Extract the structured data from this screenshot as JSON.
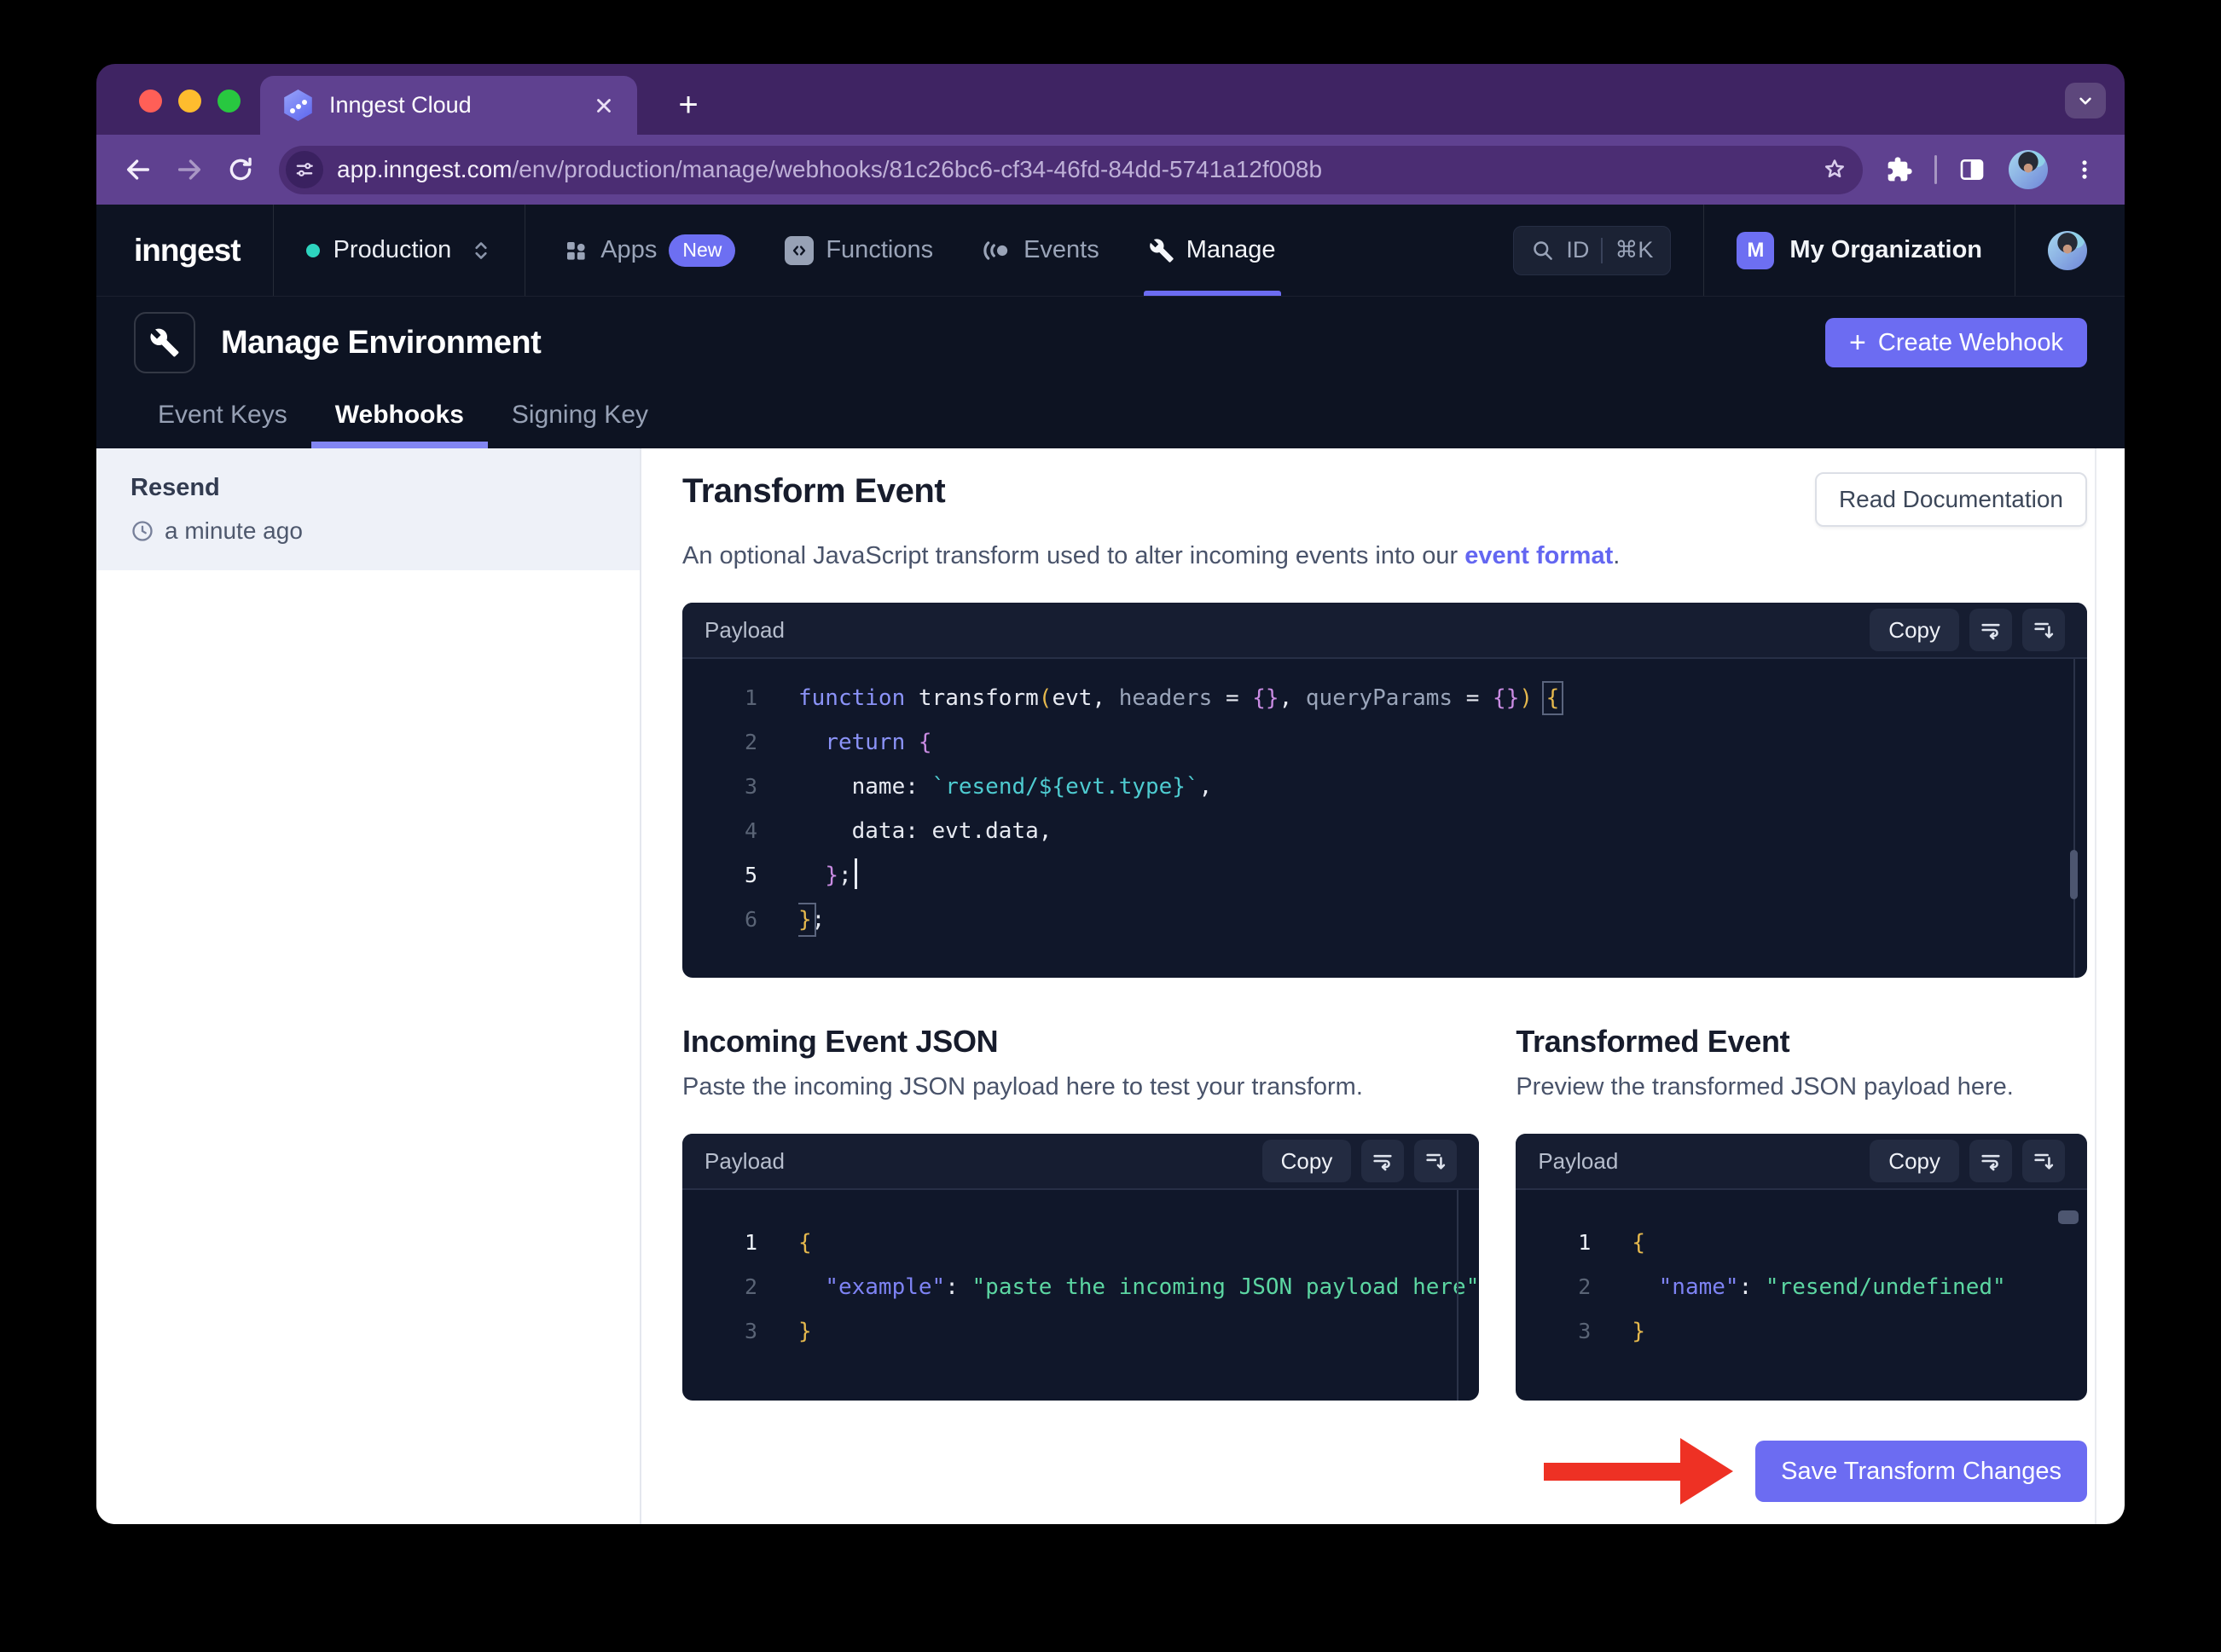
{
  "browser": {
    "tab_title": "Inngest Cloud",
    "url_host": "app.inngest.com",
    "url_path": "/env/production/manage/webhooks/81c26bc6-cf34-46fd-84dd-5741a12f008b"
  },
  "topnav": {
    "logo": "inngest",
    "env_selector": {
      "label": "Production"
    },
    "items": [
      {
        "label": "Apps",
        "badge": "New",
        "active": false
      },
      {
        "label": "Functions",
        "active": false
      },
      {
        "label": "Events",
        "active": false
      },
      {
        "label": "Manage",
        "active": true
      }
    ],
    "search": {
      "id_label": "ID",
      "shortcut": "⌘K"
    },
    "org": {
      "initial": "M",
      "name": "My Organization"
    }
  },
  "env_header": {
    "title": "Manage Environment",
    "create_button": "Create Webhook",
    "tabs": [
      {
        "label": "Event Keys",
        "active": false
      },
      {
        "label": "Webhooks",
        "active": true
      },
      {
        "label": "Signing Key",
        "active": false
      }
    ]
  },
  "sidebar": {
    "items": [
      {
        "name": "Resend",
        "time": "a minute ago"
      }
    ]
  },
  "transform": {
    "title": "Transform Event",
    "description_prefix": "An optional JavaScript transform used to alter incoming events into our ",
    "description_link": "event format",
    "description_suffix": ".",
    "read_docs_button": "Read Documentation"
  },
  "editors": {
    "panel_label": "Payload",
    "copy_label": "Copy",
    "transform_code": {
      "active": 5,
      "lines": [
        [
          {
            "c": "kw",
            "t": "function"
          },
          {
            "c": "pl",
            "t": " transform"
          },
          {
            "c": "yb",
            "t": "("
          },
          {
            "c": "pl",
            "t": "evt, "
          },
          {
            "c": "par",
            "t": "headers"
          },
          {
            "c": "pl",
            "t": " = "
          },
          {
            "c": "pb",
            "t": "{}"
          },
          {
            "c": "pl",
            "t": ", "
          },
          {
            "c": "par",
            "t": "queryParams"
          },
          {
            "c": "pl",
            "t": " = "
          },
          {
            "c": "pb",
            "t": "{}"
          },
          {
            "c": "yb",
            "t": ")"
          },
          {
            "c": "pl",
            "t": " "
          },
          {
            "c": "yb box",
            "t": "{"
          }
        ],
        [
          {
            "c": "pl",
            "t": "  "
          },
          {
            "c": "kw",
            "t": "return"
          },
          {
            "c": "pl",
            "t": " "
          },
          {
            "c": "pb",
            "t": "{"
          }
        ],
        [
          {
            "c": "pl",
            "t": "    name: "
          },
          {
            "c": "str",
            "t": "`resend/${evt.type}`"
          },
          {
            "c": "pl",
            "t": ","
          }
        ],
        [
          {
            "c": "pl",
            "t": "    data: evt.data,"
          }
        ],
        [
          {
            "c": "pl",
            "t": "  "
          },
          {
            "c": "pb",
            "t": "}"
          },
          {
            "c": "pl",
            "t": ";"
          },
          {
            "c": "cur",
            "t": ""
          }
        ],
        [
          {
            "c": "yb box",
            "t": "}"
          },
          {
            "c": "pl",
            "t": ";"
          }
        ]
      ]
    },
    "incoming": {
      "title": "Incoming Event JSON",
      "description": "Paste the incoming JSON payload here to test your transform.",
      "active": 1,
      "lines": [
        [
          {
            "c": "yb",
            "t": "{"
          }
        ],
        [
          {
            "c": "pl",
            "t": "  "
          },
          {
            "c": "key",
            "t": "\"example\""
          },
          {
            "c": "pl",
            "t": ": "
          },
          {
            "c": "grn",
            "t": "\"paste the incoming JSON payload here\""
          }
        ],
        [
          {
            "c": "yb",
            "t": "}"
          }
        ]
      ]
    },
    "transformed": {
      "title": "Transformed Event",
      "description": "Preview the transformed JSON payload here.",
      "active": 1,
      "lines": [
        [
          {
            "c": "yb",
            "t": "{"
          }
        ],
        [
          {
            "c": "pl",
            "t": "  "
          },
          {
            "c": "key",
            "t": "\"name\""
          },
          {
            "c": "pl",
            "t": ": "
          },
          {
            "c": "grn",
            "t": "\"resend/undefined\""
          }
        ],
        [
          {
            "c": "yb",
            "t": "}"
          }
        ]
      ]
    }
  },
  "save_button": "Save Transform Changes",
  "colors": {
    "accent": "#6c6cf2",
    "accent_light": "#8286f2",
    "env_dot_teal": "#2dd4bf",
    "annotation_arrow_red": "#ee3124",
    "new_badge": "#6d6ff2",
    "editor_background": "#10172a",
    "chrome_purple": "#5f4190"
  }
}
